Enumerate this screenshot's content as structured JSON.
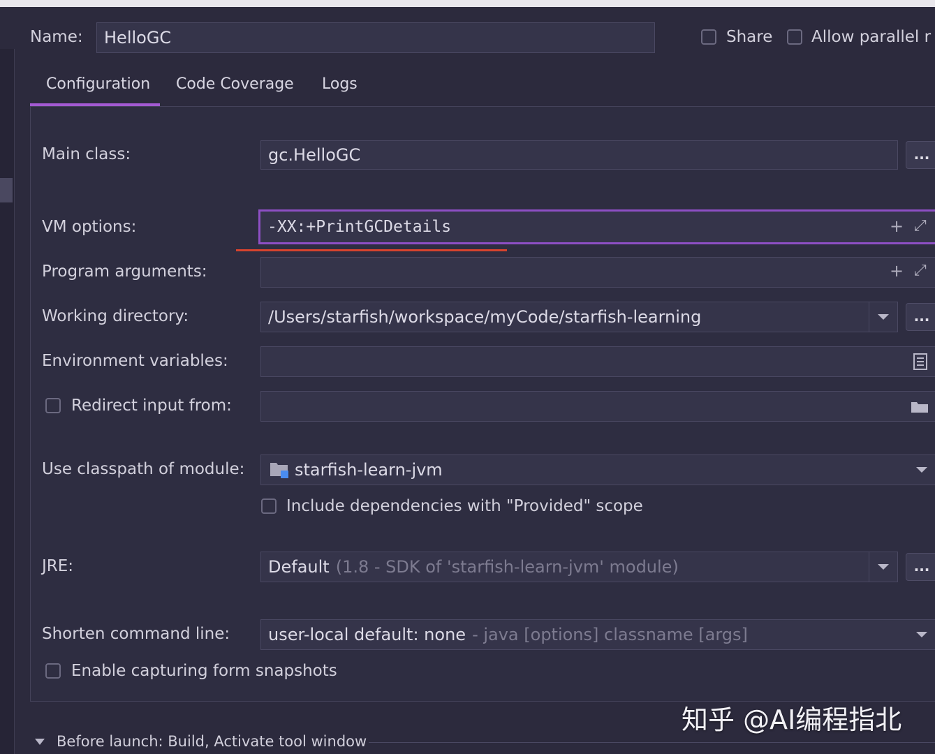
{
  "header": {
    "name_label": "Name:",
    "name_value": "HelloGC",
    "share_label": "Share",
    "allow_parallel_label": "Allow parallel r"
  },
  "tabs": [
    {
      "label": "Configuration",
      "active": true
    },
    {
      "label": "Code Coverage",
      "active": false
    },
    {
      "label": "Logs",
      "active": false
    }
  ],
  "form": {
    "main_class_label": "Main class:",
    "main_class_value": "gc.HelloGC",
    "vm_options_label": "VM options:",
    "vm_options_value": "-XX:+PrintGCDetails",
    "program_args_label": "Program arguments:",
    "program_args_value": "",
    "working_dir_label": "Working directory:",
    "working_dir_value": "/Users/starfish/workspace/myCode/starfish-learning",
    "env_vars_label": "Environment variables:",
    "env_vars_value": "",
    "redirect_label": "Redirect input from:",
    "redirect_value": "",
    "classpath_label": "Use classpath of module:",
    "classpath_value": "starfish-learn-jvm",
    "include_deps_label": "Include dependencies with \"Provided\" scope",
    "jre_label": "JRE:",
    "jre_value": "Default",
    "jre_hint": "(1.8 - SDK of 'starfish-learn-jvm' module)",
    "shorten_label": "Shorten command line:",
    "shorten_value": "user-local default: none",
    "shorten_hint": "- java [options] classname [args]",
    "snapshots_label": "Enable capturing form snapshots",
    "browse_label": "..."
  },
  "footer": {
    "before_launch_label": "Before launch: Build, Activate tool window"
  },
  "watermark": "知乎 @AI编程指北",
  "colors": {
    "background": "#2c2a3d",
    "accent": "#a35ad2",
    "annotation_underline": "#d7432e"
  },
  "icons": [
    "plus-icon",
    "expand-icon",
    "chevron-down-icon",
    "document-icon",
    "folder-icon",
    "module-folder-icon",
    "triangle-down-icon"
  ]
}
